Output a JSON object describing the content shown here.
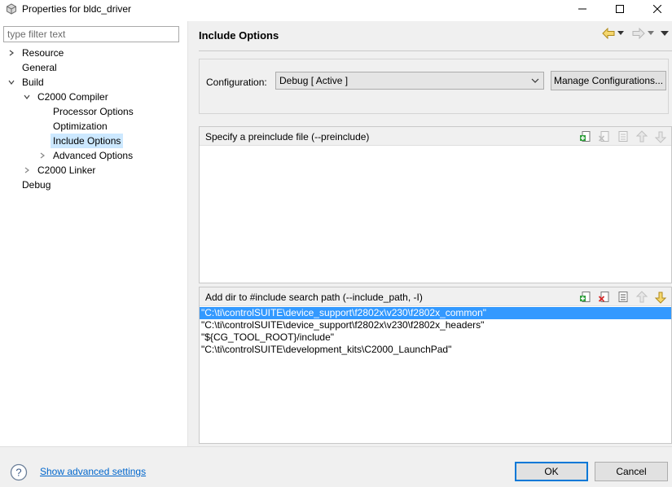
{
  "window": {
    "title": "Properties for bldc_driver",
    "minimize": "—",
    "maximize": "☐",
    "close": "✕"
  },
  "filter": {
    "placeholder": "type filter text",
    "value": ""
  },
  "tree": {
    "resource": "Resource",
    "general": "General",
    "build": "Build",
    "c2000_compiler": "C2000 Compiler",
    "processor_options": "Processor Options",
    "optimization": "Optimization",
    "include_options": "Include Options",
    "advanced_options": "Advanced Options",
    "c2000_linker": "C2000 Linker",
    "debug": "Debug"
  },
  "page": {
    "title": "Include Options"
  },
  "configuration": {
    "label": "Configuration:",
    "selected": "Debug  [ Active ]",
    "manage_label": "Manage Configurations..."
  },
  "preinclude": {
    "header": "Specify a preinclude file (--preinclude)",
    "items": []
  },
  "include_path": {
    "header": "Add dir to #include search path (--include_path, -I)",
    "items": [
      "\"C:\\ti\\controlSUITE\\device_support\\f2802x\\v230\\f2802x_common\"",
      "\"C:\\ti\\controlSUITE\\device_support\\f2802x\\v230\\f2802x_headers\"",
      "\"${CG_TOOL_ROOT}/include\"",
      "\"C:\\ti\\controlSUITE\\development_kits\\C2000_LaunchPad\""
    ],
    "selected_index": 0
  },
  "footer": {
    "show_advanced": "Show advanced settings",
    "ok": "OK",
    "cancel": "Cancel"
  },
  "colors": {
    "selection": "#3399ff",
    "tree_selection": "#cce8ff",
    "link": "#0066cc",
    "default_button_border": "#0078d7"
  }
}
